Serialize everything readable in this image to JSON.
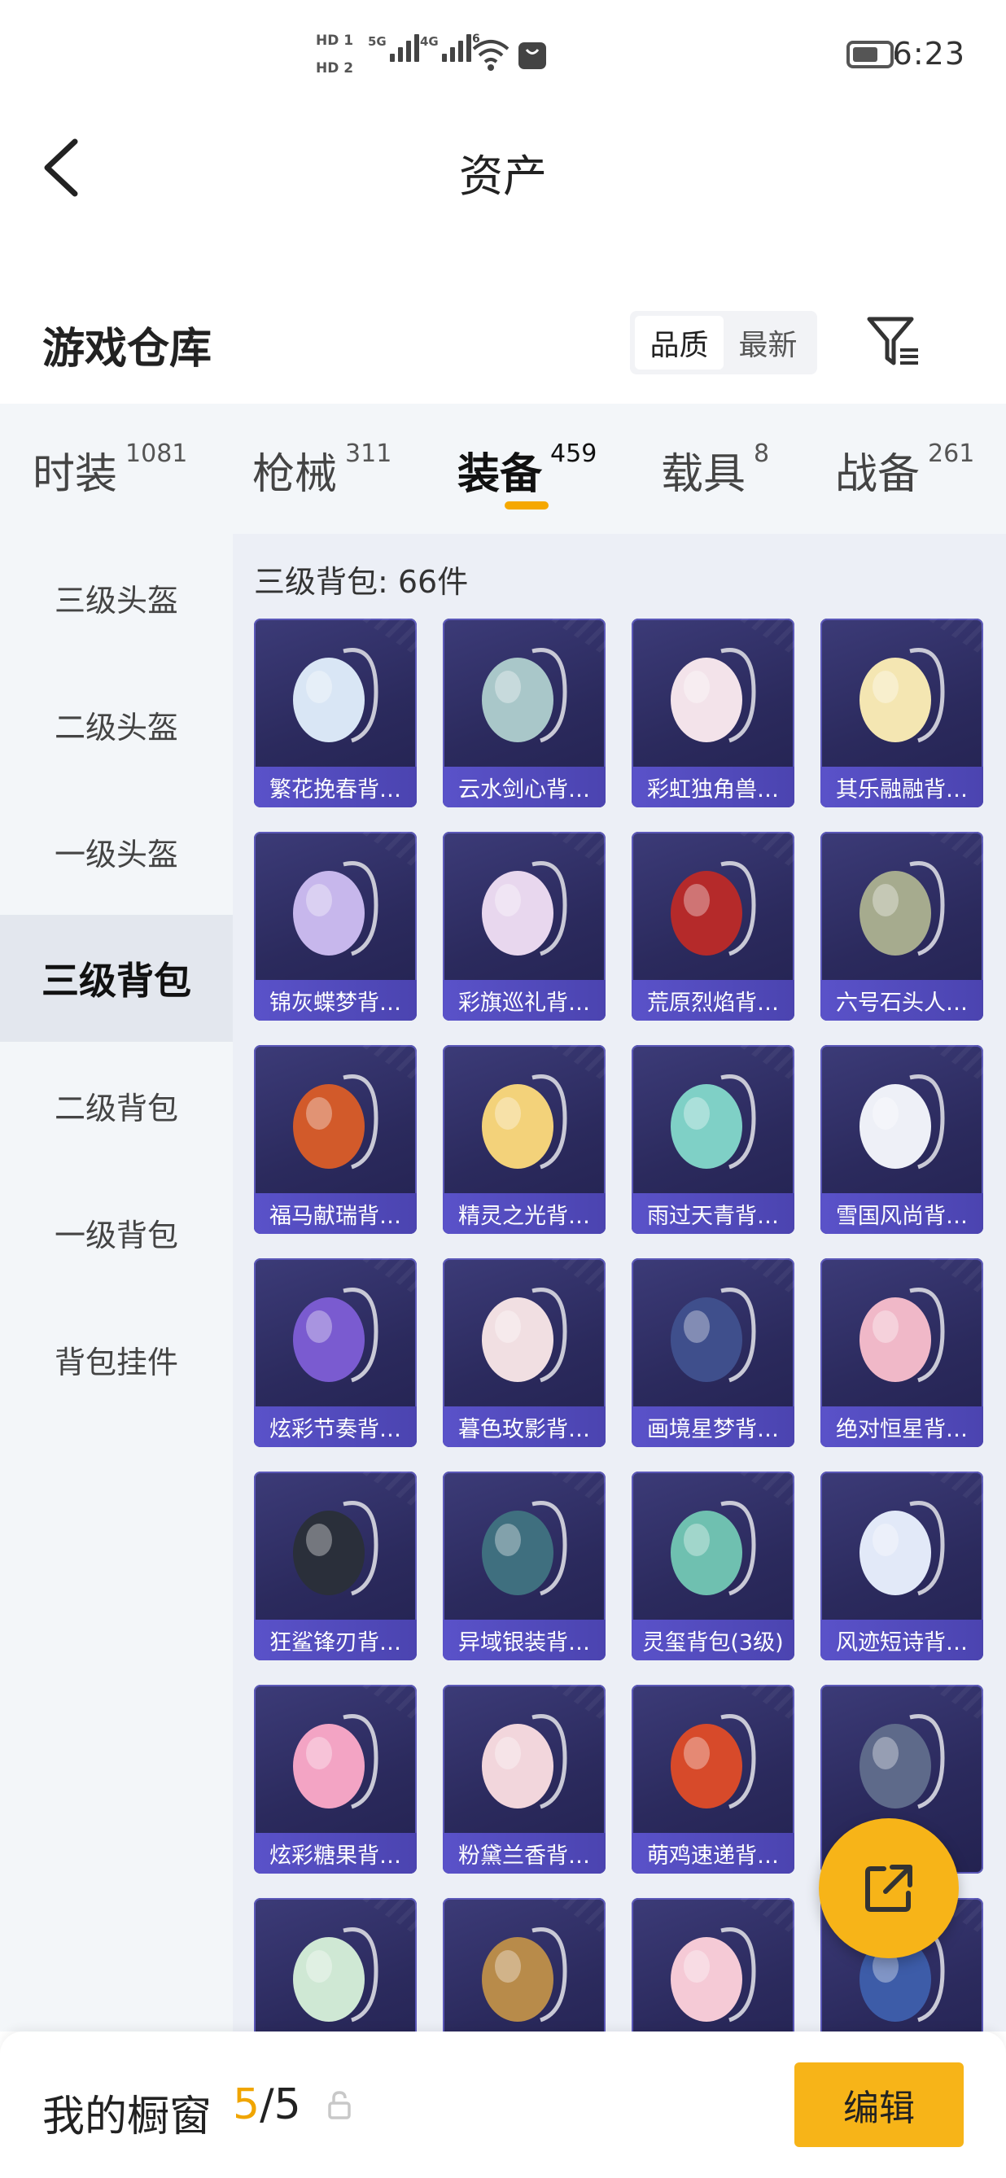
{
  "status_bar": {
    "hd1": "HD 1",
    "hd2": "HD 2",
    "net1": "5G",
    "net2": "4G",
    "wifi_badge": "6",
    "time": "6:23"
  },
  "header": {
    "title": "资产"
  },
  "warehouse": {
    "title": "游戏仓库",
    "sort_options": [
      "品质",
      "最新"
    ],
    "active_sort": "品质"
  },
  "tabs": [
    {
      "label": "时装",
      "count": "1081"
    },
    {
      "label": "枪械",
      "count": "311"
    },
    {
      "label": "装备",
      "count": "459",
      "active": true
    },
    {
      "label": "载具",
      "count": "8"
    },
    {
      "label": "战备",
      "count": "261"
    }
  ],
  "sidebar": {
    "items": [
      "三级头盔",
      "二级头盔",
      "一级头盔",
      "三级背包",
      "二级背包",
      "一级背包",
      "背包挂件"
    ],
    "active_index": 3
  },
  "section": {
    "title": "三级背包: 66件"
  },
  "items": [
    {
      "name": "繁花挽春背…",
      "color": "#d9e6f5"
    },
    {
      "name": "云水剑心背…",
      "color": "#a9c7c9"
    },
    {
      "name": "彩虹独角兽…",
      "color": "#f3e3ea"
    },
    {
      "name": "其乐融融背…",
      "color": "#f4e6b2"
    },
    {
      "name": "锦灰蝶梦背…",
      "color": "#c7b7ec"
    },
    {
      "name": "彩旗巡礼背…",
      "color": "#e8d7ee"
    },
    {
      "name": "荒原烈焰背…",
      "color": "#b52a2a"
    },
    {
      "name": "六号石头人…",
      "color": "#a6ab8e"
    },
    {
      "name": "福马献瑞背…",
      "color": "#d25a2a"
    },
    {
      "name": "精灵之光背…",
      "color": "#f3d27a"
    },
    {
      "name": "雨过天青背…",
      "color": "#7fd0c6"
    },
    {
      "name": "雪国风尚背…",
      "color": "#eef0f7"
    },
    {
      "name": "炫彩节奏背…",
      "color": "#7a5bd0"
    },
    {
      "name": "暮色玫影背…",
      "color": "#f1dfe2"
    },
    {
      "name": "画境星梦背…",
      "color": "#3f4f8c"
    },
    {
      "name": "绝对恒星背…",
      "color": "#f0b8c8"
    },
    {
      "name": "狂鲨锋刃背…",
      "color": "#2a2f3a"
    },
    {
      "name": "异域银装背…",
      "color": "#3f6f7f"
    },
    {
      "name": "灵玺背包(3级)",
      "color": "#6fc0b0"
    },
    {
      "name": "风迹短诗背…",
      "color": "#e2e9f8"
    },
    {
      "name": "炫彩糖果背…",
      "color": "#f3a4c4"
    },
    {
      "name": "粉黛兰香背…",
      "color": "#f2d6dc"
    },
    {
      "name": "萌鸡速递背…",
      "color": "#d74a2a"
    },
    {
      "name": "",
      "color": "#5e6a8a"
    },
    {
      "name": "",
      "color": "#cfe8d4"
    },
    {
      "name": "",
      "color": "#b88b4a"
    },
    {
      "name": "",
      "color": "#f5cad6"
    },
    {
      "name": "",
      "color": "#3d5ca8"
    }
  ],
  "showcase": {
    "label": "我的橱窗",
    "current": "5",
    "total": "5",
    "edit_label": "编辑"
  },
  "colors": {
    "accent": "#f7b418",
    "card_bg": "#2b2a5d",
    "card_label_bg": "#5a52c9"
  }
}
